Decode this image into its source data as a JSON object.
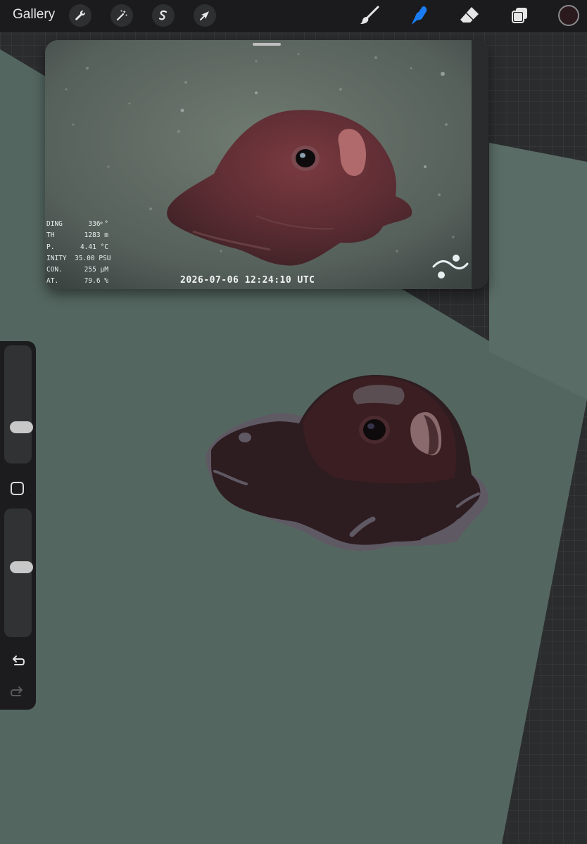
{
  "toolbar": {
    "gallery_label": "Gallery",
    "left_tools": [
      {
        "name": "actions",
        "icon": "wrench-icon"
      },
      {
        "name": "adjustments",
        "icon": "magic-wand-icon"
      },
      {
        "name": "selection",
        "icon": "selection-s-icon"
      },
      {
        "name": "transform",
        "icon": "arrow-cursor-icon"
      }
    ],
    "right_tools": [
      {
        "name": "brush",
        "icon": "brush-icon",
        "active": false
      },
      {
        "name": "smudge",
        "icon": "smudge-icon",
        "active": true
      },
      {
        "name": "eraser",
        "icon": "eraser-icon",
        "active": false
      },
      {
        "name": "layers",
        "icon": "layers-icon",
        "active": false
      }
    ],
    "current_color": "#2a1a1e",
    "active_tool_color": "#1a7cf5"
  },
  "reference": {
    "hud": [
      {
        "label": "DING",
        "value": "336 °"
      },
      {
        "label": "TH",
        "value": "1283 m"
      },
      {
        "label": "P.",
        "value": "4.41 °C"
      },
      {
        "label": "INITY",
        "value": "35.00 PSU"
      },
      {
        "label": "CON.",
        "value": "255 µM"
      },
      {
        "label": "AT.",
        "value": "79.6 %"
      }
    ],
    "timestamp": "2026-07-06 12:24:10 UTC",
    "logo_icon": "wave-logo-icon"
  },
  "sidebar": {
    "brush_size_level": 0.28,
    "opacity_level": 0.55,
    "undo_icon": "undo-icon",
    "redo_icon": "redo-icon"
  },
  "colors": {
    "canvas": "#546660",
    "octopus_body": "#2d1c20",
    "octopus_shadow": "#5f5964",
    "app_background": "#2b2c2e"
  }
}
